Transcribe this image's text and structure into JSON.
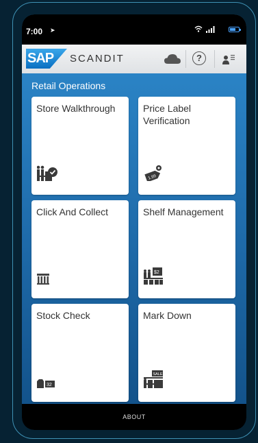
{
  "status_bar": {
    "time": "7:00"
  },
  "app_bar": {
    "logo_text": "SAP",
    "brand_name": "SCANDIT"
  },
  "section_title": "Retail Operations",
  "tiles": [
    {
      "label": "Store Walkthrough",
      "icon": "store-check-icon"
    },
    {
      "label": "Price Label Verification",
      "icon": "price-tag-icon",
      "tag_text": "1.99"
    },
    {
      "label": "Click And Collect",
      "icon": "pickup-counter-icon"
    },
    {
      "label": "Shelf Management",
      "icon": "shelf-price-icon",
      "tag_text": "$2"
    },
    {
      "label": "Stock Check",
      "icon": "stock-count-icon",
      "tag_text": "32"
    },
    {
      "label": "Mark Down",
      "icon": "sale-sign-icon",
      "tag_text": "SALE"
    }
  ],
  "footer": {
    "label": "ABOUT"
  },
  "colors": {
    "accent": "#2f8ccf",
    "app_bar": "#e6e8ea",
    "footer": "#000000"
  }
}
